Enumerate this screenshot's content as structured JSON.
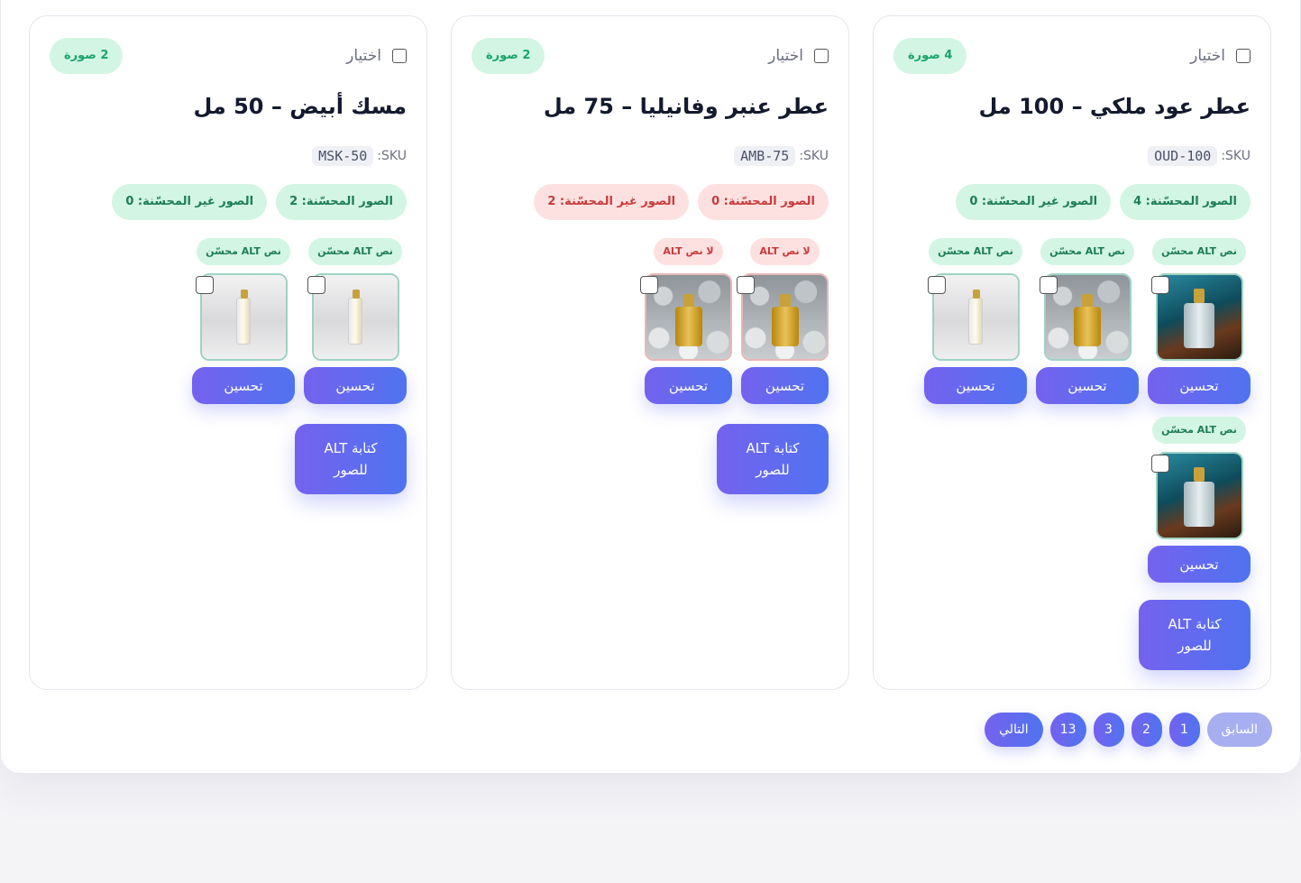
{
  "cards": [
    {
      "select_label": "اختيار",
      "image_count": "4 صورة",
      "title": "عطر عود ملكي – 100 مل",
      "sku_label": "SKU:",
      "sku": "OUD-100",
      "stat_optimized": "الصور المحسّنة: 4",
      "stat_unoptimized": "الصور غير المحسّنة: 0",
      "images": [
        {
          "alt_status": "نص ALT محسّن",
          "button": "تحسين"
        },
        {
          "alt_status": "نص ALT محسّن",
          "button": "تحسين"
        },
        {
          "alt_status": "نص ALT محسّن",
          "button": "تحسين"
        },
        {
          "alt_status": "نص ALT محسّن",
          "button": "تحسين"
        }
      ],
      "write_button": "كتابة ALT\nللصور"
    },
    {
      "select_label": "اختيار",
      "image_count": "2 صورة",
      "title": "عطر عنبر وفانيليا – 75 مل",
      "sku_label": "SKU:",
      "sku": "AMB-75",
      "stat_optimized": "الصور المحسّنة: 0",
      "stat_unoptimized": "الصور غير المحسّنة: 2",
      "images": [
        {
          "alt_status": "لا نص ALT",
          "button": "تحسين"
        },
        {
          "alt_status": "لا نص ALT",
          "button": "تحسين"
        }
      ],
      "write_button": "كتابة ALT\nللصور"
    },
    {
      "select_label": "اختيار",
      "image_count": "2 صورة",
      "title": "مسك أبيض – 50 مل",
      "sku_label": "SKU:",
      "sku": "MSK-50",
      "stat_optimized": "الصور المحسّنة: 2",
      "stat_unoptimized": "الصور غير المحسّنة: 0",
      "images": [
        {
          "alt_status": "نص ALT محسّن",
          "button": "تحسين"
        },
        {
          "alt_status": "نص ALT محسّن",
          "button": "تحسين"
        }
      ],
      "write_button": "كتابة ALT\nللصور"
    }
  ],
  "pagination": {
    "prev": "السابق",
    "pages": [
      "1",
      "2",
      "3",
      "13"
    ],
    "next": "التالي"
  },
  "colors": {
    "accent_start": "#7562ef",
    "accent_end": "#4f73f0",
    "success_bg": "#d3f5e4",
    "success_text": "#1c7d55",
    "danger_bg": "#fde1e1",
    "danger_text": "#c83a3a"
  }
}
